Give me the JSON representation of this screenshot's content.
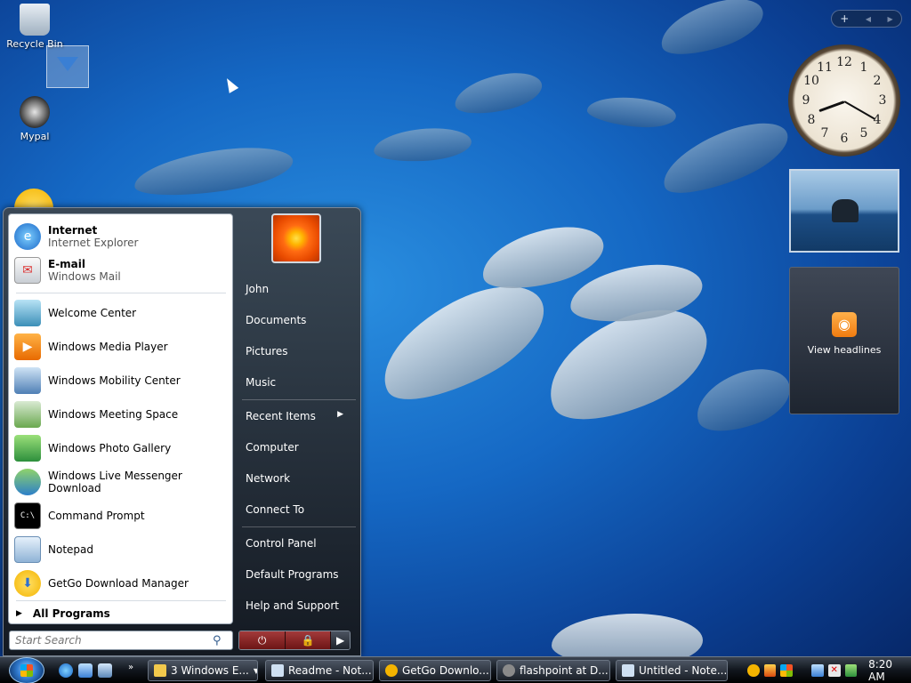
{
  "desktop": {
    "icons": [
      {
        "label": "Recycle Bin"
      },
      {
        "label": "Mypal"
      }
    ]
  },
  "sidebar": {
    "add_button": "+",
    "prev_arrow": "◀",
    "next_arrow": "▶",
    "clock_numbers": [
      "12",
      "1",
      "2",
      "3",
      "4",
      "5",
      "6",
      "7",
      "8",
      "9",
      "10",
      "11"
    ],
    "feed_text": "View headlines"
  },
  "start_menu": {
    "pinned": [
      {
        "title": "Internet",
        "subtitle": "Internet Explorer"
      },
      {
        "title": "E-mail",
        "subtitle": "Windows Mail"
      }
    ],
    "recent": [
      {
        "label": "Welcome Center"
      },
      {
        "label": "Windows Media Player"
      },
      {
        "label": "Windows Mobility Center"
      },
      {
        "label": "Windows Meeting Space"
      },
      {
        "label": "Windows Photo Gallery"
      },
      {
        "label": "Windows Live Messenger Download"
      },
      {
        "label": "Command Prompt"
      },
      {
        "label": "Notepad"
      },
      {
        "label": "GetGo Download Manager"
      }
    ],
    "all_programs": "All Programs",
    "search_placeholder": "Start Search",
    "right_items": [
      {
        "label": "John"
      },
      {
        "label": "Documents"
      },
      {
        "label": "Pictures"
      },
      {
        "label": "Music"
      },
      {
        "label": "Recent Items"
      },
      {
        "label": "Computer"
      },
      {
        "label": "Network"
      },
      {
        "label": "Connect To"
      },
      {
        "label": "Control Panel"
      },
      {
        "label": "Default Programs"
      },
      {
        "label": "Help and Support"
      }
    ]
  },
  "taskbar": {
    "tasks": [
      {
        "label": "3 Windows E..."
      },
      {
        "label": "Readme - Not..."
      },
      {
        "label": "GetGo Downlo..."
      },
      {
        "label": "flashpoint at D..."
      },
      {
        "label": "Untitled - Note..."
      }
    ],
    "time": "8:20 AM"
  },
  "colors": {
    "accent": "#1568c4",
    "shutdown_red": "#a33a3a"
  }
}
